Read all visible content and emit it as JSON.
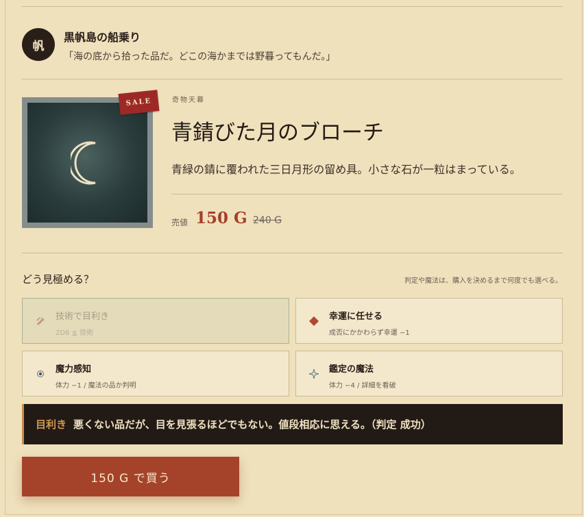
{
  "merchant": {
    "avatar_glyph": "帆",
    "name": "黒帆島の船乗り",
    "quote": "「海の底から拾った品だ。どこの海かまでは野暮ってもんだ。」"
  },
  "item": {
    "badge": "SALE",
    "category": "奇物天幕",
    "title": "青錆びた月のブローチ",
    "description": "青緑の錆に覆われた三日月形の留め具。小さな石が一粒はまっている。",
    "price_label": "売値",
    "price": "150 G",
    "old_price": "240 G",
    "image_icon": "crescent-moon-icon"
  },
  "appraisal": {
    "title": "どう見極める？",
    "note": "判定や魔法は、購入を決めるまで何度でも選べる。",
    "options": [
      {
        "label": "技術で目利き",
        "sub": "2D6 ≦ 技術",
        "icon": "hammer-pick-icon",
        "state": "used"
      },
      {
        "label": "幸運に任せる",
        "sub": "成否にかかわらず幸運 −1",
        "icon": "diamond-icon",
        "state": "available"
      },
      {
        "label": "魔力感知",
        "sub": "体力 −1 / 魔法の品か判明",
        "icon": "target-dot-icon",
        "state": "available"
      },
      {
        "label": "鑑定の魔法",
        "sub": "体力 −4 / 詳細を看破",
        "icon": "sparkle-icon",
        "state": "available"
      }
    ]
  },
  "result": {
    "tag": "目利き",
    "message": "悪くない品だが、目を見張るほどでもない。値段相応に思える。（判定 成功）"
  },
  "buy_button": "150 G で買う",
  "colors": {
    "background": "#f0e1bd",
    "accent": "#a5432a",
    "sale": "#9d2927",
    "dark_panel": "#221a15"
  }
}
